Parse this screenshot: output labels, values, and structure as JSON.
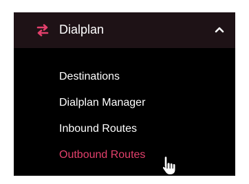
{
  "menu": {
    "title": "Dialplan",
    "icon": "exchange-arrows-icon",
    "expand_icon": "chevron-up-icon",
    "accent_color": "#e3406c",
    "items": [
      {
        "label": "Destinations",
        "active": false
      },
      {
        "label": "Dialplan Manager",
        "active": false
      },
      {
        "label": "Inbound Routes",
        "active": false
      },
      {
        "label": "Outbound Routes",
        "active": true
      }
    ]
  },
  "pointer": {
    "icon": "hand-pointer-cursor-icon"
  }
}
